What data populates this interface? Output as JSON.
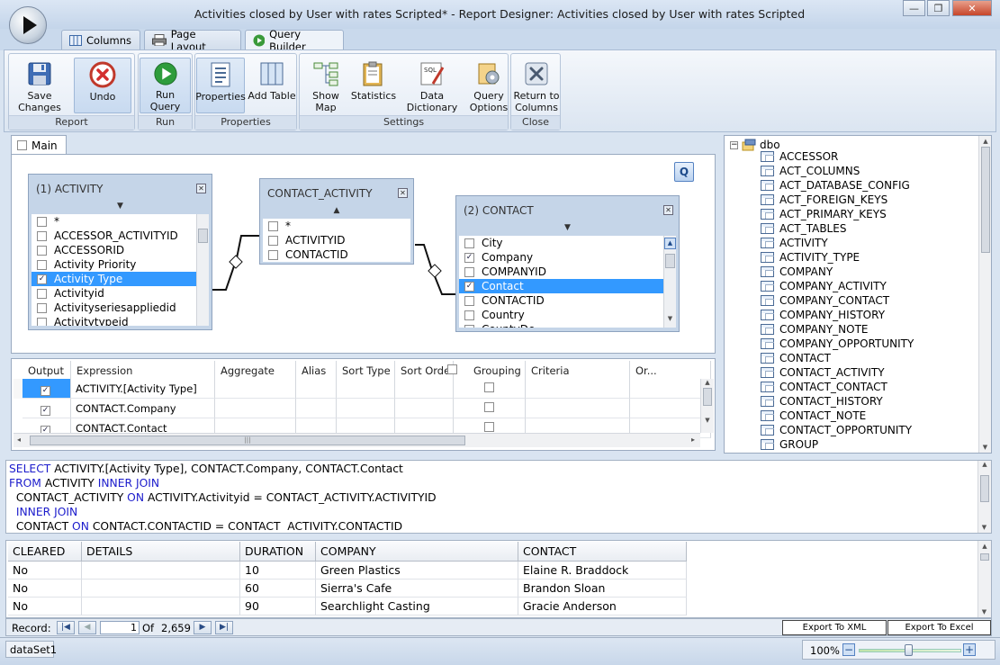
{
  "window": {
    "title": "Activities closed by User with rates Scripted* - Report Designer: Activities closed by User with rates Scripted",
    "minimize": "—",
    "restore": "❐",
    "close": "✕"
  },
  "tabs": [
    {
      "label": "Columns",
      "icon": "columns-icon"
    },
    {
      "label": "Page Layout",
      "icon": "printer-icon"
    },
    {
      "label": "Query Builder",
      "icon": "play-icon"
    }
  ],
  "ribbon": {
    "groups": {
      "report": "Report",
      "run": "Run",
      "properties": "Properties",
      "settings": "Settings",
      "close": "Close"
    },
    "buttons": {
      "save_line1": "Save",
      "save_line2": "Changes",
      "undo": "Undo",
      "run_query": "Run Query",
      "properties": "Properties",
      "add_table": "Add Table",
      "show_map": "Show Map",
      "statistics": "Statistics",
      "data_dictionary": "Data Dictionary",
      "query_options_line1": "Query",
      "query_options_line2": "Options",
      "return_line1": "Return to",
      "return_line2": "Columns"
    }
  },
  "main_tab": "Main",
  "q_button": "Q",
  "tables": {
    "activity": {
      "title": "(1) ACTIVITY",
      "rows": [
        {
          "label": "*",
          "checked": false
        },
        {
          "label": "ACCESSOR_ACTIVITYID",
          "checked": false
        },
        {
          "label": "ACCESSORID",
          "checked": false
        },
        {
          "label": "Activity Priority",
          "checked": false
        },
        {
          "label": "Activity Type",
          "checked": true
        },
        {
          "label": "Activityid",
          "checked": false
        },
        {
          "label": "Activityseriesappliedid",
          "checked": false
        },
        {
          "label": "Activitytypeid",
          "checked": false
        }
      ]
    },
    "contact_activity": {
      "title": "CONTACT_ACTIVITY",
      "rows": [
        {
          "label": "*",
          "checked": false
        },
        {
          "label": "ACTIVITYID",
          "checked": false
        },
        {
          "label": "CONTACTID",
          "checked": false
        }
      ]
    },
    "contact": {
      "title": "(2) CONTACT",
      "rows": [
        {
          "label": "City",
          "checked": false
        },
        {
          "label": "Company",
          "checked": true
        },
        {
          "label": "COMPANYID",
          "checked": false
        },
        {
          "label": "Contact",
          "checked": true
        },
        {
          "label": "CONTACTID",
          "checked": false
        },
        {
          "label": "Country",
          "checked": false
        },
        {
          "label": "CountyDe",
          "checked": false
        }
      ]
    }
  },
  "grid": {
    "headers": [
      "Output",
      "Expression",
      "Aggregate",
      "Alias",
      "Sort Type",
      "Sort Order",
      "Grouping",
      "Criteria",
      "Or..."
    ],
    "rows": [
      {
        "expression": "ACTIVITY.[Activity Type]",
        "output": true
      },
      {
        "expression": "CONTACT.Company",
        "output": true
      },
      {
        "expression": "CONTACT.Contact",
        "output": true
      }
    ]
  },
  "tree": {
    "root": "dbo",
    "items": [
      "ACCESSOR",
      "ACT_COLUMNS",
      "ACT_DATABASE_CONFIG",
      "ACT_FOREIGN_KEYS",
      "ACT_PRIMARY_KEYS",
      "ACT_TABLES",
      "ACTIVITY",
      "ACTIVITY_TYPE",
      "COMPANY",
      "COMPANY_ACTIVITY",
      "COMPANY_CONTACT",
      "COMPANY_HISTORY",
      "COMPANY_NOTE",
      "COMPANY_OPPORTUNITY",
      "CONTACT",
      "CONTACT_ACTIVITY",
      "CONTACT_CONTACT",
      "CONTACT_HISTORY",
      "CONTACT_NOTE",
      "CONTACT_OPPORTUNITY",
      "GROUP"
    ]
  },
  "sql": {
    "l1_kw": "SELECT",
    "l1": " ACTIVITY.[Activity Type], CONTACT.Company, CONTACT.Contact",
    "l2_kw": "FROM",
    "l2": " ACTIVITY ",
    "l2_kw2": "INNER JOIN",
    "l3a": "  CONTACT_ACTIVITY ",
    "l3_kw": "ON",
    "l3b": " ACTIVITY.Activityid = CONTACT_ACTIVITY.ACTIVITYID",
    "l4_kw": "  INNER JOIN",
    "l5a": "  CONTACT ",
    "l5_kw": "ON",
    "l5b": " CONTACT.CONTACTID = CONTACT  ACTIVITY.CONTACTID"
  },
  "results": {
    "headers": [
      "CLEARED",
      "DETAILS",
      "DURATION",
      "COMPANY",
      "CONTACT"
    ],
    "rows": [
      [
        "No",
        "",
        "10",
        "Green Plastics",
        "Elaine R. Braddock"
      ],
      [
        "No",
        "",
        "60",
        "Sierra's Cafe",
        "Brandon Sloan"
      ],
      [
        "No",
        "",
        "90",
        "Searchlight Casting",
        "Gracie Anderson"
      ]
    ]
  },
  "nav": {
    "record_label": "Record:",
    "current": "1",
    "of_label": "Of",
    "total": "2,659",
    "export_xml": "Export To XML",
    "export_excel": "Export To Excel"
  },
  "status": {
    "dataset": "dataSet1",
    "zoom": "100%",
    "zoom_minus": "−",
    "zoom_plus": "+"
  }
}
